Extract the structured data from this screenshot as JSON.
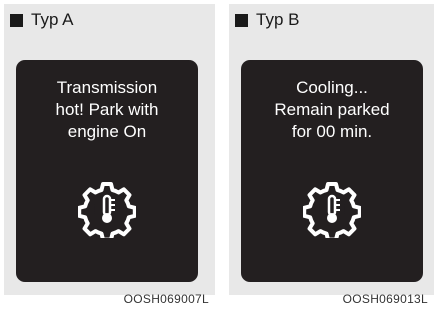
{
  "panels": [
    {
      "label": "Typ A",
      "message": "Transmission\nhot! Park with\nengine On",
      "icon": "gear-thermometer-icon",
      "code": "OOSH069007L"
    },
    {
      "label": "Typ B",
      "message": "Cooling...\nRemain parked\nfor 00 min.",
      "icon": "gear-thermometer-icon",
      "code": "OOSH069013L"
    }
  ],
  "colors": {
    "screen_bg": "#231f20",
    "panel_bg": "#e8e8e8",
    "text_light": "#ffffff"
  }
}
